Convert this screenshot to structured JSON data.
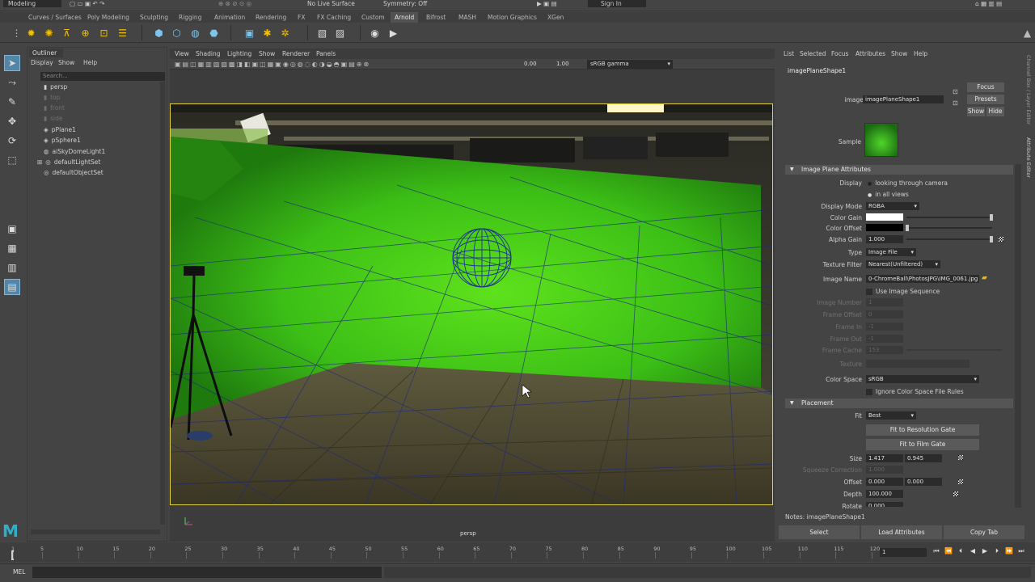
{
  "topbar": {
    "mode": "Modeling",
    "live_surface": "No Live Surface",
    "symmetry": "Symmetry: Off",
    "signin": "Sign In"
  },
  "shelf_tabs": [
    {
      "label": "Curves / Surfaces",
      "active": false
    },
    {
      "label": "Poly Modeling",
      "active": false
    },
    {
      "label": "Sculpting",
      "active": false
    },
    {
      "label": "Rigging",
      "active": false
    },
    {
      "label": "Animation",
      "active": false
    },
    {
      "label": "Rendering",
      "active": false
    },
    {
      "label": "FX",
      "active": false
    },
    {
      "label": "FX Caching",
      "active": false
    },
    {
      "label": "Custom",
      "active": false
    },
    {
      "label": "Arnold",
      "active": true
    },
    {
      "label": "Bifrost",
      "active": false
    },
    {
      "label": "MASH",
      "active": false
    },
    {
      "label": "Motion Graphics",
      "active": false
    },
    {
      "label": "XGen",
      "active": false
    }
  ],
  "outliner": {
    "title": "Outliner",
    "menu": [
      "Display",
      "Show",
      "Help"
    ],
    "search_placeholder": "Search...",
    "items": [
      {
        "label": "persp",
        "icon": "camera-icon",
        "dim": false
      },
      {
        "label": "top",
        "icon": "camera-icon",
        "dim": true
      },
      {
        "label": "front",
        "icon": "camera-icon",
        "dim": true
      },
      {
        "label": "side",
        "icon": "camera-icon",
        "dim": true
      },
      {
        "label": "pPlane1",
        "icon": "mesh-icon",
        "dim": false
      },
      {
        "label": "pSphere1",
        "icon": "mesh-icon",
        "dim": false
      },
      {
        "label": "aiSkyDomeLight1",
        "icon": "light-icon",
        "dim": false
      },
      {
        "label": "defaultLightSet",
        "icon": "set-icon",
        "dim": false
      },
      {
        "label": "defaultObjectSet",
        "icon": "set-icon",
        "dim": false
      }
    ]
  },
  "viewport": {
    "menu": [
      "View",
      "Shading",
      "Lighting",
      "Show",
      "Renderer",
      "Panels"
    ],
    "exposure": "0.00",
    "gamma": "1.00",
    "colorspace": "sRGB gamma",
    "camera_label": "persp"
  },
  "attribute_editor": {
    "menu": [
      "List",
      "Selected",
      "Focus",
      "Attributes",
      "Show",
      "Help"
    ],
    "tab": "imagePlaneShape1",
    "node_label": "imagePlane:",
    "node_value": "imagePlaneShape1",
    "focus_btn": "Focus",
    "presets_btn": "Presets",
    "show_btn": "Show",
    "hide_btn": "Hide",
    "sample_label": "Sample",
    "section1": "Image Plane Attributes",
    "display_label": "Display",
    "display_opt1": "looking through camera",
    "display_opt2": "in all views",
    "display_mode_label": "Display Mode",
    "display_mode": "RGBA",
    "color_gain_label": "Color Gain",
    "color_offset_label": "Color Offset",
    "alpha_gain_label": "Alpha Gain",
    "alpha_gain": "1.000",
    "type_label": "Type",
    "type": "Image File",
    "texture_filter_label": "Texture Filter",
    "texture_filter": "Nearest(Unfiltered)",
    "image_name_label": "Image Name",
    "image_name": "0-ChromeBall\\PhotosJPG\\IMG_0061.jpg",
    "use_sequence": "Use Image Sequence",
    "image_number_label": "Image Number",
    "image_number": "1",
    "frame_offset_label": "Frame Offset",
    "frame_offset": "0",
    "frame_in_label": "Frame In",
    "frame_in": "-1",
    "frame_out_label": "Frame Out",
    "frame_out": "-1",
    "frame_cache_label": "Frame Cache",
    "frame_cache": "153",
    "texture_label": "Texture",
    "color_space_label": "Color Space",
    "color_space": "sRGB",
    "ignore_rules": "Ignore Color Space File Rules",
    "section2": "Placement",
    "fit_label": "Fit",
    "fit": "Best",
    "fit_res_btn": "Fit to Resolution Gate",
    "fit_film_btn": "Fit to Film Gate",
    "size_label": "Size",
    "size_x": "1.417",
    "size_y": "0.945",
    "squeeze_label": "Squeeze Correction",
    "squeeze": "1.000",
    "offset_label": "Offset",
    "offset_x": "0.000",
    "offset_y": "0.000",
    "depth_label": "Depth",
    "depth": "100.000",
    "rotate_label": "Rotate",
    "rotate": "0.000",
    "notes": "Notes: imagePlaneShape1",
    "select_btn": "Select",
    "load_btn": "Load Attributes",
    "copy_btn": "Copy Tab"
  },
  "side_tabs": [
    "Channel Box / Layer Editor",
    "Attribute Editor"
  ],
  "timeline": {
    "ticks": [
      "1",
      "5",
      "10",
      "15",
      "20",
      "25",
      "30",
      "35",
      "40",
      "45",
      "50",
      "55",
      "60",
      "65",
      "70",
      "75",
      "80",
      "85",
      "90",
      "95",
      "100",
      "105",
      "110",
      "115",
      "120"
    ],
    "current_frame": "1"
  },
  "cmdline": {
    "label": "MEL"
  },
  "colors": {
    "accent": "#5285a6",
    "green_screen": "#3fbf1a",
    "logo": "#2fb0c8"
  }
}
